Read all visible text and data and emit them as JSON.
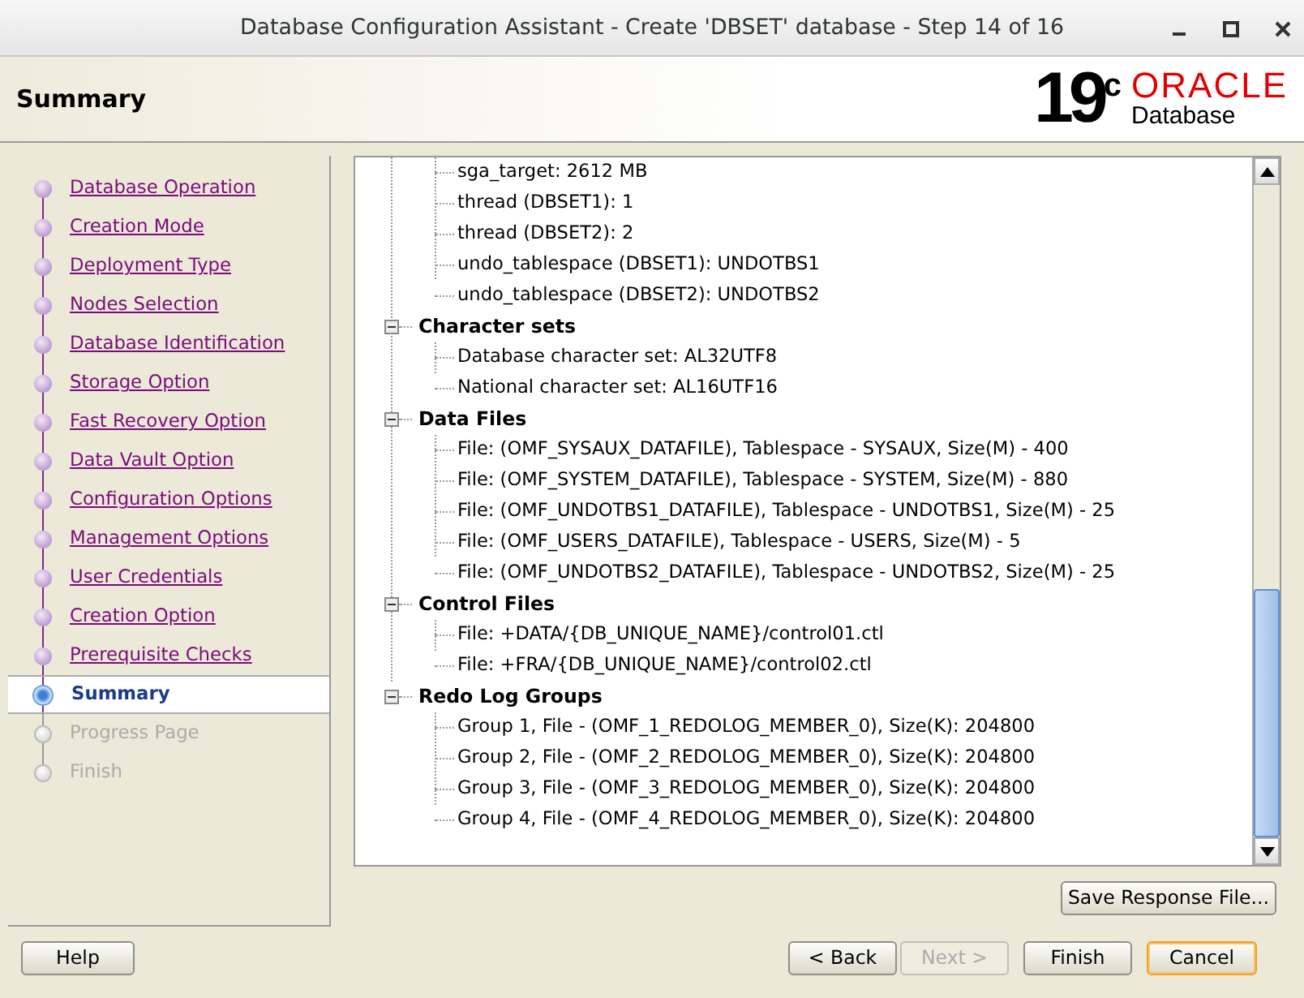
{
  "window": {
    "title": "Database Configuration Assistant - Create 'DBSET' database - Step 14 of 16"
  },
  "header": {
    "title": "Summary",
    "logo": {
      "version": "19",
      "superscript": "c",
      "brand": "ORACLE",
      "product": "Database"
    }
  },
  "steps": [
    {
      "label": "Database Operation",
      "selected": false,
      "disabled": false
    },
    {
      "label": "Creation Mode",
      "selected": false,
      "disabled": false
    },
    {
      "label": "Deployment Type",
      "selected": false,
      "disabled": false
    },
    {
      "label": "Nodes Selection",
      "selected": false,
      "disabled": false
    },
    {
      "label": "Database Identification",
      "selected": false,
      "disabled": false
    },
    {
      "label": "Storage Option",
      "selected": false,
      "disabled": false
    },
    {
      "label": "Fast Recovery Option",
      "selected": false,
      "disabled": false
    },
    {
      "label": "Data Vault Option",
      "selected": false,
      "disabled": false
    },
    {
      "label": "Configuration Options",
      "selected": false,
      "disabled": false
    },
    {
      "label": "Management Options",
      "selected": false,
      "disabled": false
    },
    {
      "label": "User Credentials",
      "selected": false,
      "disabled": false
    },
    {
      "label": "Creation Option",
      "selected": false,
      "disabled": false
    },
    {
      "label": "Prerequisite Checks",
      "selected": false,
      "disabled": false
    },
    {
      "label": "Summary",
      "selected": true,
      "disabled": false
    },
    {
      "label": "Progress Page",
      "selected": false,
      "disabled": true
    },
    {
      "label": "Finish",
      "selected": false,
      "disabled": true
    }
  ],
  "tree": [
    {
      "children": [
        "sga_target: 2612 MB",
        "thread (DBSET1): 1",
        "thread (DBSET2): 2",
        "undo_tablespace (DBSET1): UNDOTBS1",
        "undo_tablespace (DBSET2): UNDOTBS2"
      ]
    },
    {
      "label": "Character sets",
      "expanded": true,
      "children": [
        "Database character set: AL32UTF8",
        "National character set: AL16UTF16"
      ]
    },
    {
      "label": "Data Files",
      "expanded": true,
      "children": [
        "File: (OMF_SYSAUX_DATAFILE), Tablespace - SYSAUX, Size(M) - 400",
        "File: (OMF_SYSTEM_DATAFILE), Tablespace - SYSTEM, Size(M) - 880",
        "File: (OMF_UNDOTBS1_DATAFILE), Tablespace - UNDOTBS1, Size(M) - 25",
        "File: (OMF_USERS_DATAFILE), Tablespace - USERS, Size(M) - 5",
        "File: (OMF_UNDOTBS2_DATAFILE), Tablespace - UNDOTBS2, Size(M) - 25"
      ]
    },
    {
      "label": "Control Files",
      "expanded": true,
      "children": [
        "File: +DATA/{DB_UNIQUE_NAME}/control01.ctl",
        "File: +FRA/{DB_UNIQUE_NAME}/control02.ctl"
      ]
    },
    {
      "label": "Redo Log Groups",
      "expanded": true,
      "children": [
        "Group 1, File - (OMF_1_REDOLOG_MEMBER_0), Size(K): 204800",
        "Group 2, File - (OMF_2_REDOLOG_MEMBER_0), Size(K): 204800",
        "Group 3, File - (OMF_3_REDOLOG_MEMBER_0), Size(K): 204800",
        "Group 4, File - (OMF_4_REDOLOG_MEMBER_0), Size(K): 204800"
      ]
    }
  ],
  "save_button": "Save Response File...",
  "buttons": [
    {
      "kind": "help",
      "label": "Help",
      "disabled": false,
      "focused": false
    },
    {
      "kind": "nav",
      "label": "< Back",
      "disabled": false,
      "focused": false
    },
    {
      "kind": "nav",
      "label": "Next >",
      "disabled": true,
      "focused": false
    },
    {
      "kind": "finish",
      "label": "Finish",
      "disabled": false,
      "focused": false
    },
    {
      "kind": "cancel",
      "label": "Cancel",
      "disabled": false,
      "focused": true
    }
  ]
}
